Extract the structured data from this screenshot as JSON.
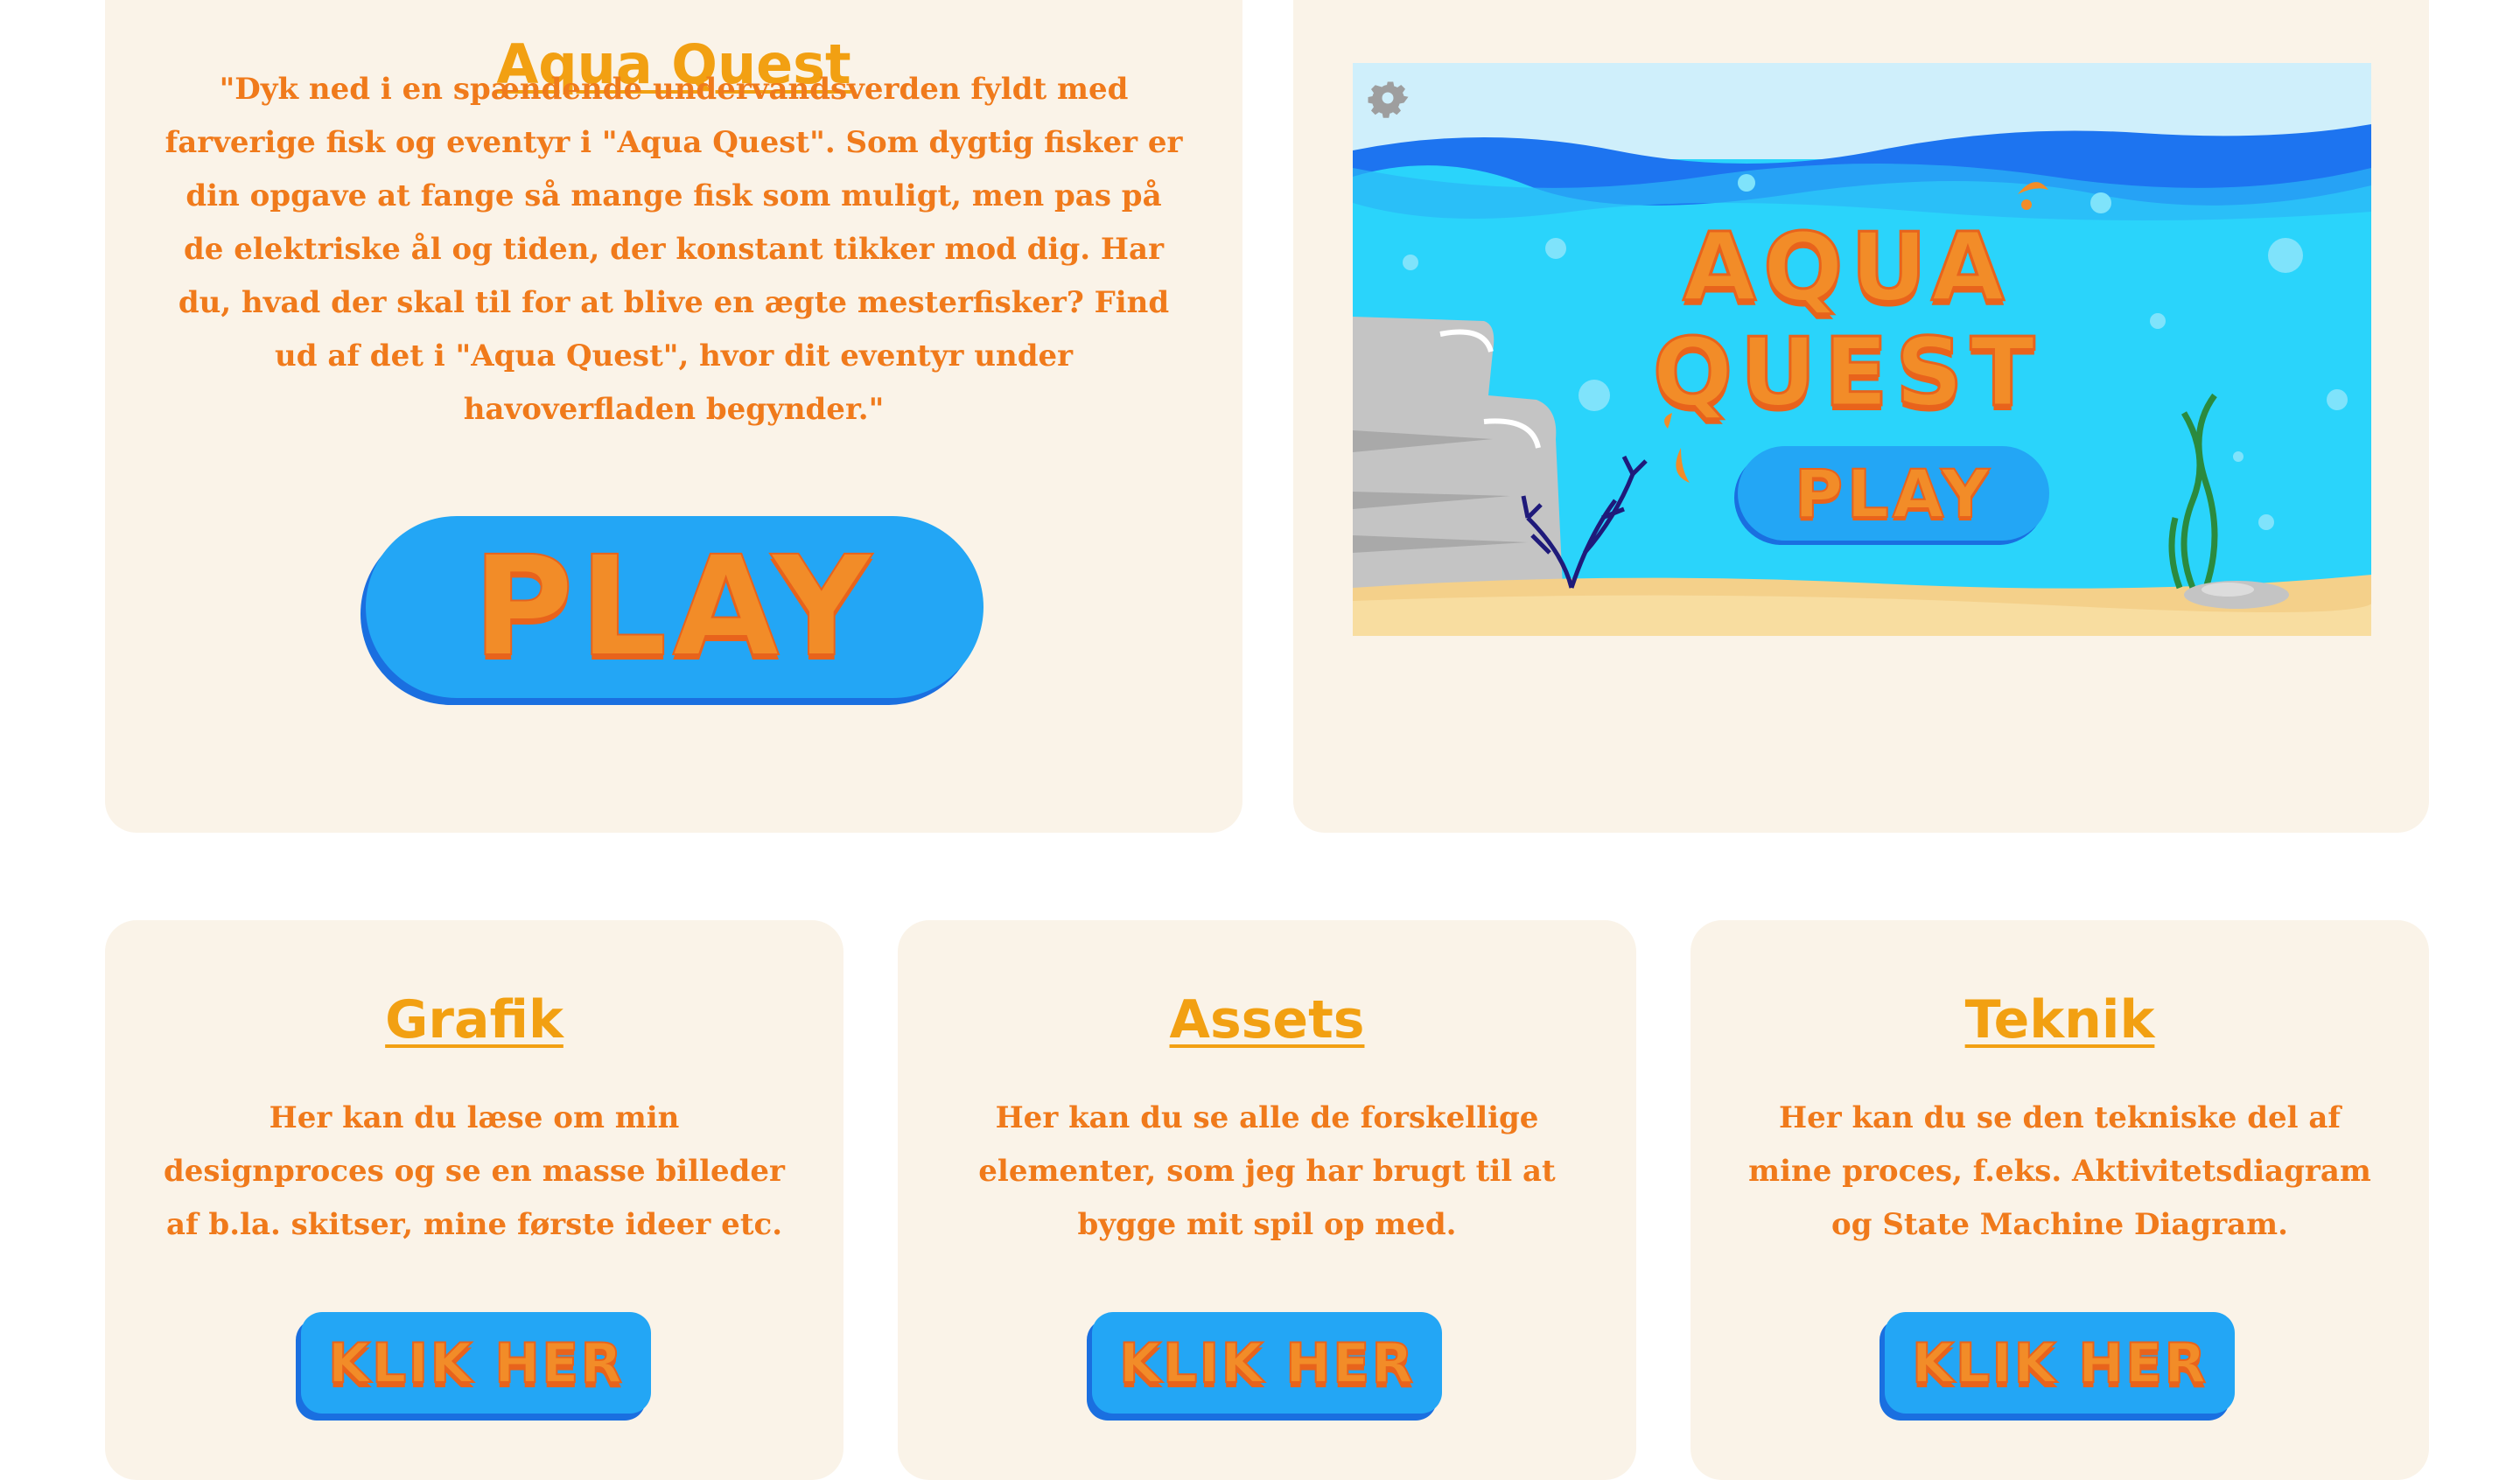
{
  "hero": {
    "title": "Aqua Quest",
    "description": "\"Dyk ned i en spændende undervandsverden fyldt med farverige fisk og eventyr i \"Aqua Quest\". Som dygtig fisker er din opgave at fange så mange fisk som muligt, men pas på de elektriske ål og tiden, der konstant tikker mod dig. Har du, hvad der skal til for at blive en ægte mesterfisker? Find ud af det i \"Aqua Quest\", hvor dit eventyr under havoverfladen begynder.\"",
    "play_label": "PLAY"
  },
  "preview": {
    "game_title_line1": "AQUA",
    "game_title_line2": "QUEST",
    "play_label": "PLAY",
    "settings_icon": "gear-icon"
  },
  "sections": [
    {
      "title": "Grafik",
      "description": "Her kan du læse om min designproces og se en masse billeder af b.la. skitser, mine første ideer etc.",
      "button_label": "KLIK HER"
    },
    {
      "title": "Assets",
      "description": "Her kan du se alle de forskellige elementer, som jeg har brugt til at bygge mit spil op med.",
      "button_label": "KLIK HER"
    },
    {
      "title": "Teknik",
      "description": "Her kan du se den tekniske del af mine proces, f.eks. Aktivitetsdiagram og State Machine Diagram.",
      "button_label": "KLIK HER"
    }
  ],
  "colors": {
    "card_background": "#faf3e8",
    "title_color": "#f2a012",
    "text_color": "#f07a1b",
    "button_blue": "#23a6f5",
    "button_text": "#f28c28"
  }
}
